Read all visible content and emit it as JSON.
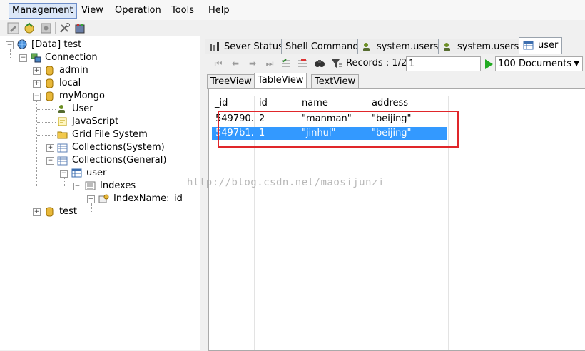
{
  "menu": {
    "items": [
      {
        "label": "Management",
        "key": "M"
      },
      {
        "label": "View",
        "key": "V"
      },
      {
        "label": "Operation",
        "key": "O"
      },
      {
        "label": "Tools",
        "key": "T"
      },
      {
        "label": "Help",
        "key": "H"
      }
    ]
  },
  "tree": {
    "root": "[Data]  test",
    "connection": "Connection",
    "dbs": [
      "admin",
      "local",
      "myMongo",
      "test"
    ],
    "mymongo_children": [
      "User",
      "JavaScript",
      "Grid File System",
      "Collections(System)",
      "Collections(General)"
    ],
    "collection": "user",
    "indexes": "Indexes",
    "index_name": "IndexName:_id_"
  },
  "tabs": [
    "Sever Status",
    "Shell Command",
    "system.users",
    "system.users",
    "user"
  ],
  "navbar": {
    "records_label": "Records : 1/2",
    "record_input": "1",
    "page_size": "100  Documents"
  },
  "subtabs": [
    "TreeView",
    "TableView",
    "TextView"
  ],
  "table": {
    "columns": [
      "_id",
      "id",
      "name",
      "address"
    ],
    "rows": [
      {
        "_id": "549790...",
        "id": "2",
        "name": "\"manman\"",
        "address": "\"beijing\""
      },
      {
        "_id": "5497b1...",
        "id": "1",
        "name": "\"jinhui\"",
        "address": "\"beijing\""
      }
    ]
  },
  "watermark": "http://blog.csdn.net/maosijunzi",
  "colors": {
    "selection": "#3399ff",
    "highlight_box": "#e0262a"
  }
}
